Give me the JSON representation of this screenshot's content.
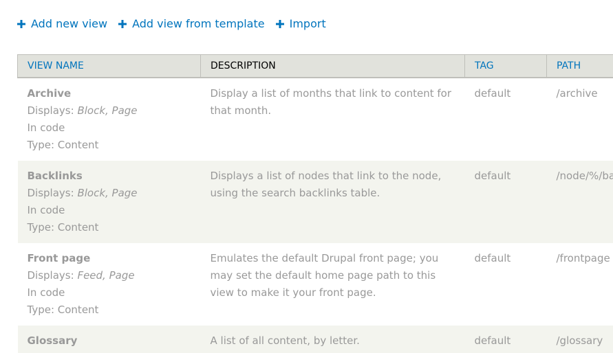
{
  "actions": [
    {
      "label": "Add new view"
    },
    {
      "label": "Add view from template"
    },
    {
      "label": "Import"
    }
  ],
  "columns": [
    "VIEW NAME",
    "DESCRIPTION",
    "TAG",
    "PATH"
  ],
  "rows": [
    {
      "name": "Archive",
      "displays_prefix": "Displays: ",
      "displays": "Block, Page",
      "storage": "In code",
      "type": "Type: Content",
      "description": "Display a list of months that link to content for that month.",
      "tag": "default",
      "path": "/archive"
    },
    {
      "name": "Backlinks",
      "displays_prefix": "Displays: ",
      "displays": "Block, Page",
      "storage": "In code",
      "type": "Type: Content",
      "description": "Displays a list of nodes that link to the node, using the search backlinks table.",
      "tag": "default",
      "path": "/node/%/backlinks"
    },
    {
      "name": "Front page",
      "displays_prefix": "Displays: ",
      "displays": "Feed, Page",
      "storage": "In code",
      "type": "Type: Content",
      "description": "Emulates the default Drupal front page; you may set the default home page path to this view to make it your front page.",
      "tag": "default",
      "path": "/frontpage"
    },
    {
      "name": "Glossary",
      "displays_prefix": "",
      "displays": "",
      "storage": "",
      "type": "",
      "description": "A list of all content, by letter.",
      "tag": "default",
      "path": "/glossary"
    }
  ]
}
